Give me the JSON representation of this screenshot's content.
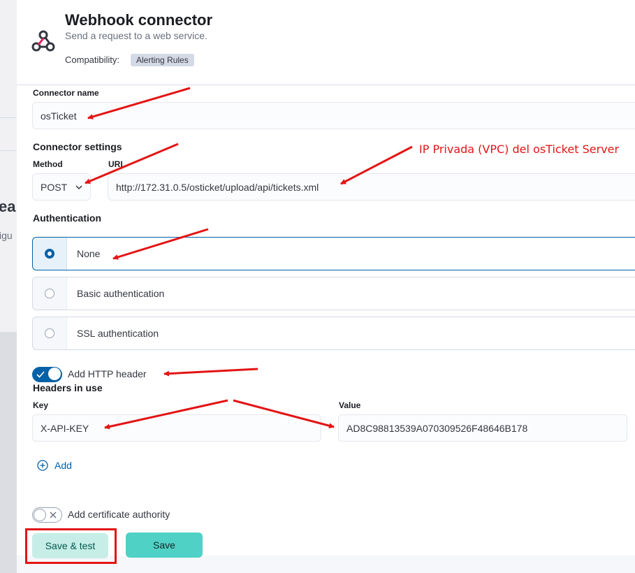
{
  "flyout": {
    "title": "Webhook connector",
    "subtitle": "Send a request to a web service.",
    "compatibility_label": "Compatibility:",
    "compatibility_badge": "Alerting Rules",
    "logo_icon": "webhook-icon"
  },
  "backdrop": {
    "fragment_heading": "ea",
    "fragment_text": "igu"
  },
  "form": {
    "connector_name_label": "Connector name",
    "connector_name_value": "osTicket",
    "connector_settings_title": "Connector settings",
    "method_label": "Method",
    "method_value": "POST",
    "url_label": "URL",
    "url_value": "http://172.31.0.5/osticket/upload/api/tickets.xml",
    "authentication_title": "Authentication",
    "auth_options": [
      {
        "label": "None",
        "selected": true
      },
      {
        "label": "Basic authentication",
        "selected": false
      },
      {
        "label": "SSL authentication",
        "selected": false
      }
    ],
    "http_header_toggle_label": "Add HTTP header",
    "http_header_toggle_on": true,
    "headers_title": "Headers in use",
    "key_label": "Key",
    "key_value": "X-API-KEY",
    "value_label": "Value",
    "value_value": "AD8C98813539A070309526F48646B178",
    "add_label": "Add",
    "cert_toggle_label": "Add certificate authority",
    "cert_toggle_on": false
  },
  "footer": {
    "save_test_label": "Save & test",
    "save_label": "Save"
  },
  "annotation": {
    "callout_text": "IP Privada (VPC) del osTicket Server",
    "color": "#e31414"
  },
  "colors": {
    "accent": "#0061a6",
    "primary_button": "#4fd1c5",
    "secondary_button": "#c7ede7"
  }
}
